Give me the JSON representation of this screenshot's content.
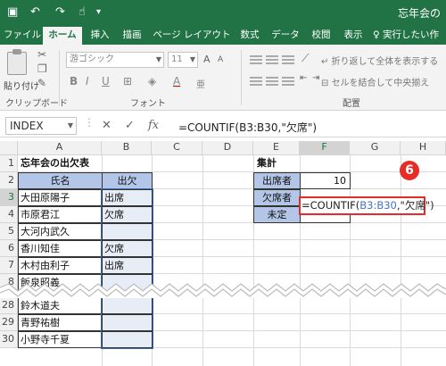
{
  "window": {
    "title": "忘年会の"
  },
  "tabs": [
    "ファイル",
    "ホーム",
    "挿入",
    "描画",
    "ページ レイアウト",
    "数式",
    "データ",
    "校閲",
    "表示",
    "実行したい作"
  ],
  "ribbon": {
    "paste_label": "貼り付け",
    "clipboard_label": "クリップボード",
    "font_label": "フォント",
    "align_label": "配置",
    "font_name": "游ゴシック",
    "font_size": "11",
    "wrap_text": "折り返して全体を表示する",
    "merge_center": "セルを結合して中央揃え"
  },
  "formula_bar": {
    "name_box": "INDEX",
    "formula": "=COUNTIF(B3:B30,\"欠席\")"
  },
  "columns": [
    "A",
    "B",
    "C",
    "D",
    "E",
    "F",
    "G",
    "H"
  ],
  "rows": [
    "1",
    "2",
    "3",
    "4",
    "5",
    "6",
    "7",
    "8",
    "28",
    "29",
    "30"
  ],
  "sheet": {
    "title": "忘年会の出欠表",
    "header_name": "氏名",
    "header_attend": "出欠",
    "names": [
      "大田原陽子",
      "市原君江",
      "大河内武久",
      "香川知佳",
      "木村由利子",
      "飯泉昭義",
      "鈴木道夫",
      "青野祐樹",
      "小野寺千夏"
    ],
    "attend": [
      "出席",
      "欠席",
      "",
      "欠席",
      "出席",
      "",
      "",
      "",
      ""
    ],
    "summary_title": "集計",
    "summary_labels": [
      "出席者",
      "欠席者",
      "未定"
    ],
    "attendee_count": "10",
    "editing_prefix": "=COUNTIF(",
    "editing_ref": "B3:B30",
    "editing_suffix": ",\"欠席\")"
  },
  "annotation": {
    "step": "6"
  },
  "colors": {
    "accent": "#217346",
    "highlight": "#e52d27",
    "header_fill": "#b4c6e7"
  }
}
